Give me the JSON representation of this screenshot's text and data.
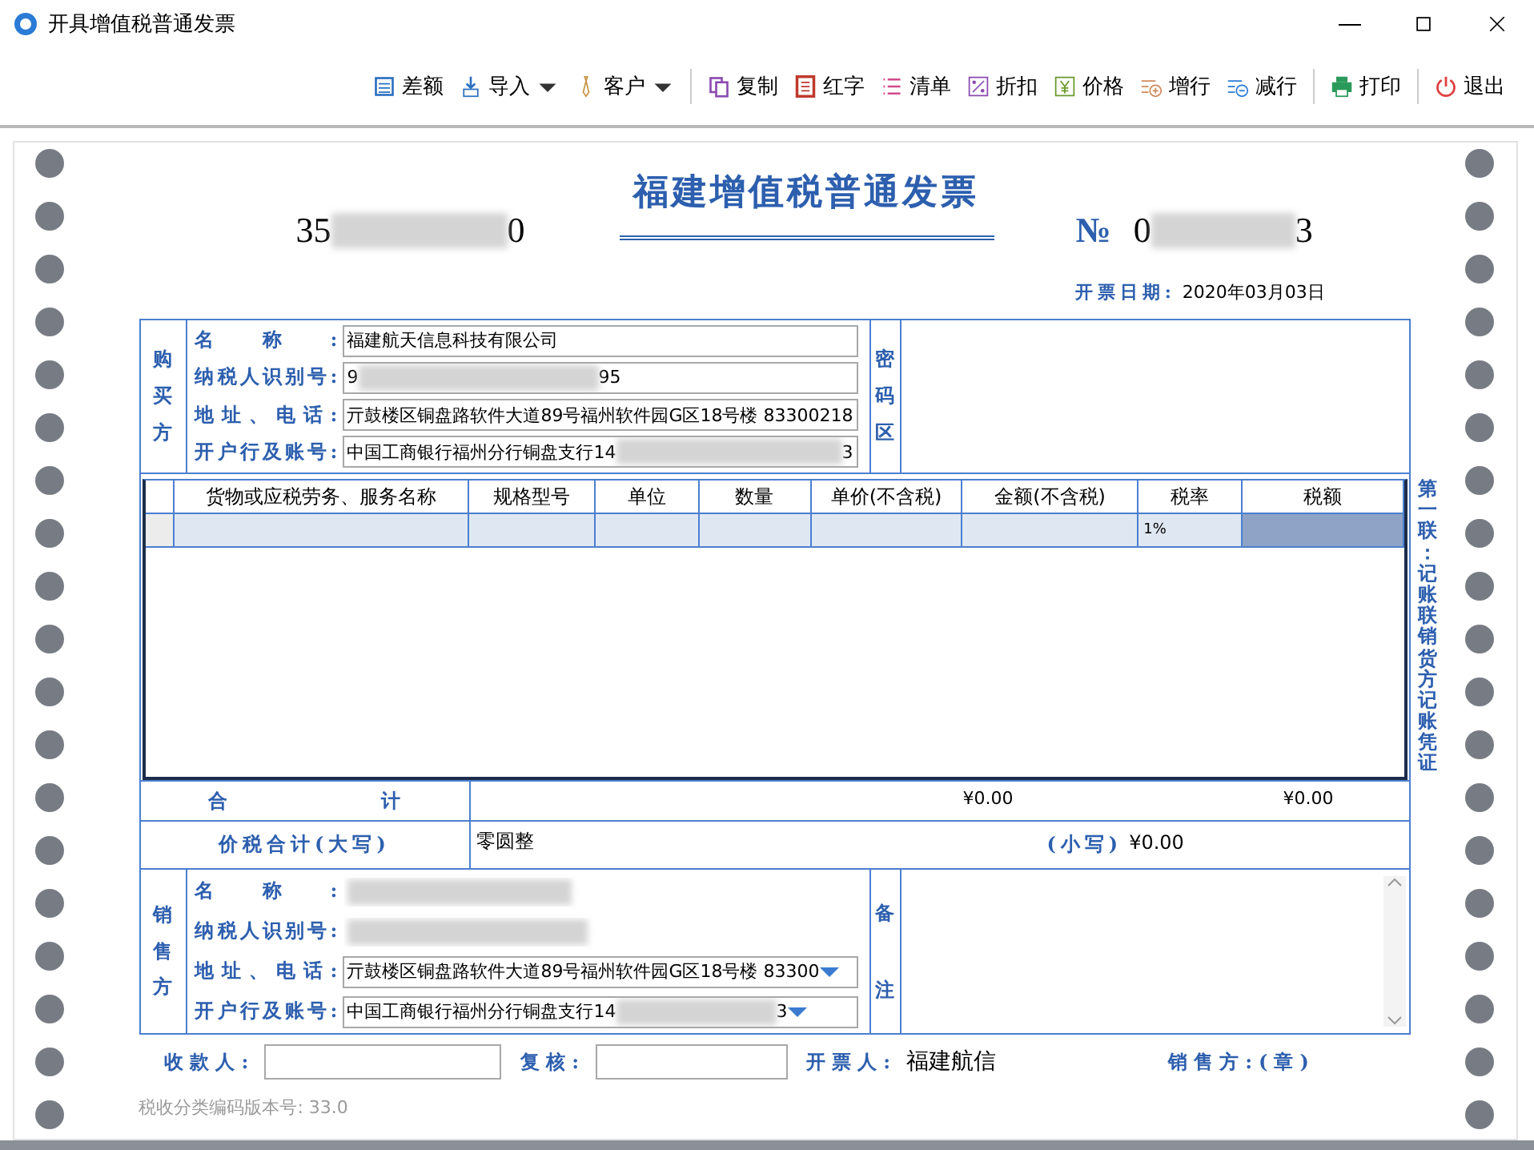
{
  "window": {
    "title": "开具增值税普通发票"
  },
  "toolbar_groups": [
    [
      {
        "label": "差额",
        "kind": "button"
      },
      {
        "label": "导入",
        "kind": "dropdown"
      },
      {
        "label": "客户",
        "kind": "dropdown"
      }
    ],
    [
      {
        "label": "复制",
        "kind": "button"
      },
      {
        "label": "红字",
        "kind": "button"
      },
      {
        "label": "清单",
        "kind": "button"
      },
      {
        "label": "折扣",
        "kind": "button"
      },
      {
        "label": "价格",
        "kind": "button"
      },
      {
        "label": "增行",
        "kind": "button"
      },
      {
        "label": "减行",
        "kind": "button"
      }
    ],
    [
      {
        "label": "打印",
        "kind": "button"
      }
    ],
    [
      {
        "label": "退出",
        "kind": "button"
      }
    ]
  ],
  "invoice": {
    "title": "福建增值税普通发票",
    "code_start": "35",
    "code_end": "0",
    "number_mark": "№",
    "number_start": "0",
    "number_end": "3",
    "date_label": "开票日期:",
    "date": "2020年03月03日"
  },
  "buyer": {
    "side_label": "购买方",
    "secret_label": "密码区",
    "fields": [
      {
        "label": "名称:",
        "kind": "text",
        "value": "福建航天信息科技有限公司"
      },
      {
        "label": "纳税人识别号:",
        "kind": "partly_blurred",
        "value": "9",
        "value_end": "95"
      },
      {
        "label": "地址、电话:",
        "kind": "text",
        "value": "亓鼓楼区铜盘路软件大道89号福州软件园G区18号楼  83300218"
      },
      {
        "label": "开户行及账号:",
        "kind": "partly_blurred",
        "value": "中国工商银行福州分行铜盘支行14",
        "value_end": "3"
      }
    ]
  },
  "items": {
    "columns": [
      "货物或应税劳务、服务名称",
      "规格型号",
      "单位",
      "数量",
      "单价(不含税)",
      "金额(不含税)",
      "税率",
      "税额"
    ],
    "rows": [
      {
        "selected": true,
        "cells": [
          {
            "focused": false
          },
          {
            "focused": false
          },
          {
            "focused": false
          },
          {
            "focused": false
          },
          {
            "focused": false
          },
          {
            "focused": false
          },
          {
            "text": "1%",
            "focused": false
          },
          {
            "focused": true
          }
        ]
      }
    ]
  },
  "totals": {
    "label": "合计",
    "amount": "¥0.00",
    "tax": "¥0.00"
  },
  "total_in_words": {
    "label": "价税合计(大写)",
    "words": "零圆整",
    "small_label": "(小写)",
    "small_value": "¥0.00"
  },
  "seller": {
    "side_label": "销售方",
    "remarks_label": "备注",
    "fields": [
      {
        "label": "名称:",
        "kind": "blurred"
      },
      {
        "label": "纳税人识别号:",
        "kind": "blurred"
      },
      {
        "label": "地址、电话:",
        "kind": "dropdown",
        "value": "亓鼓楼区铜盘路软件大道89号福州软件园G区18号楼  83300"
      },
      {
        "label": "开户行及账号:",
        "kind": "blurred_dropdown",
        "value": "中国工商银行福州分行铜盘支行14",
        "value_end": "3"
      }
    ]
  },
  "side_note": "第一联：记账联销货方记账凭证",
  "footer": {
    "payee_label": "收款人:",
    "reviewer_label": "复核:",
    "drawer_label": "开票人:",
    "drawer": "福建航信",
    "seal": "销售方:(章)"
  },
  "version": "税收分类编码版本号: 33.0"
}
